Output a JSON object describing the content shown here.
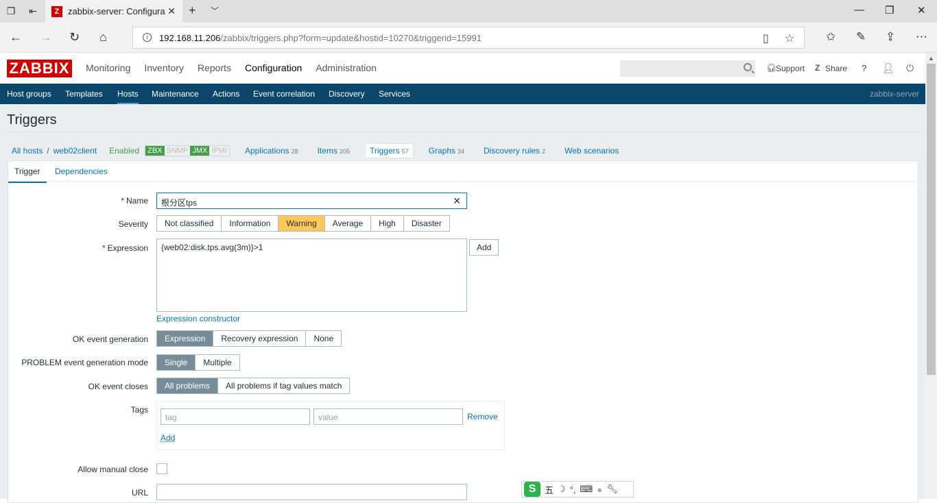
{
  "browser": {
    "tab_title": "zabbix-server: Configuration of triggers",
    "url_host": "192.168.11.206",
    "url_path": "/zabbix/triggers.php?form=update&hostid=10270&triggerid=15991"
  },
  "header": {
    "logo": "ZABBIX",
    "menu": [
      "Monitoring",
      "Inventory",
      "Reports",
      "Configuration",
      "Administration"
    ],
    "support": "Support",
    "share": "Share",
    "help": "?"
  },
  "subnav": {
    "items": [
      "Host groups",
      "Templates",
      "Hosts",
      "Maintenance",
      "Actions",
      "Event correlation",
      "Discovery",
      "Services"
    ],
    "server": "zabbix-server"
  },
  "page": {
    "title": "Triggers",
    "breadcrumb": {
      "all_hosts": "All hosts",
      "host": "web02client",
      "status": "Enabled",
      "badges": [
        "ZBX",
        "SNMP",
        "JMX",
        "IPMI"
      ],
      "links": [
        {
          "label": "Applications",
          "count": "28"
        },
        {
          "label": "Items",
          "count": "205"
        },
        {
          "label": "Triggers",
          "count": "57"
        },
        {
          "label": "Graphs",
          "count": "34"
        },
        {
          "label": "Discovery rules",
          "count": "2"
        },
        {
          "label": "Web scenarios",
          "count": ""
        }
      ]
    }
  },
  "form": {
    "tabs": [
      "Trigger",
      "Dependencies"
    ],
    "name_label": "Name",
    "name_value": "根分区tps",
    "severity_label": "Severity",
    "severity_options": [
      "Not classified",
      "Information",
      "Warning",
      "Average",
      "High",
      "Disaster"
    ],
    "severity_selected": "Warning",
    "expression_label": "Expression",
    "expression_value": "{web02:disk.tps.avg(3m)}>1",
    "add_button": "Add",
    "expression_constructor": "Expression constructor",
    "ok_event_generation_label": "OK event generation",
    "ok_event_generation_options": [
      "Expression",
      "Recovery expression",
      "None"
    ],
    "problem_mode_label": "PROBLEM event generation mode",
    "problem_mode_options": [
      "Single",
      "Multiple"
    ],
    "ok_event_closes_label": "OK event closes",
    "ok_event_closes_options": [
      "All problems",
      "All problems if tag values match"
    ],
    "tags_label": "Tags",
    "tag_placeholder": "tag",
    "value_placeholder": "value",
    "remove_link": "Remove",
    "add_link": "Add",
    "manual_close_label": "Allow manual close",
    "url_label": "URL"
  },
  "ime": {
    "mode": "五"
  }
}
